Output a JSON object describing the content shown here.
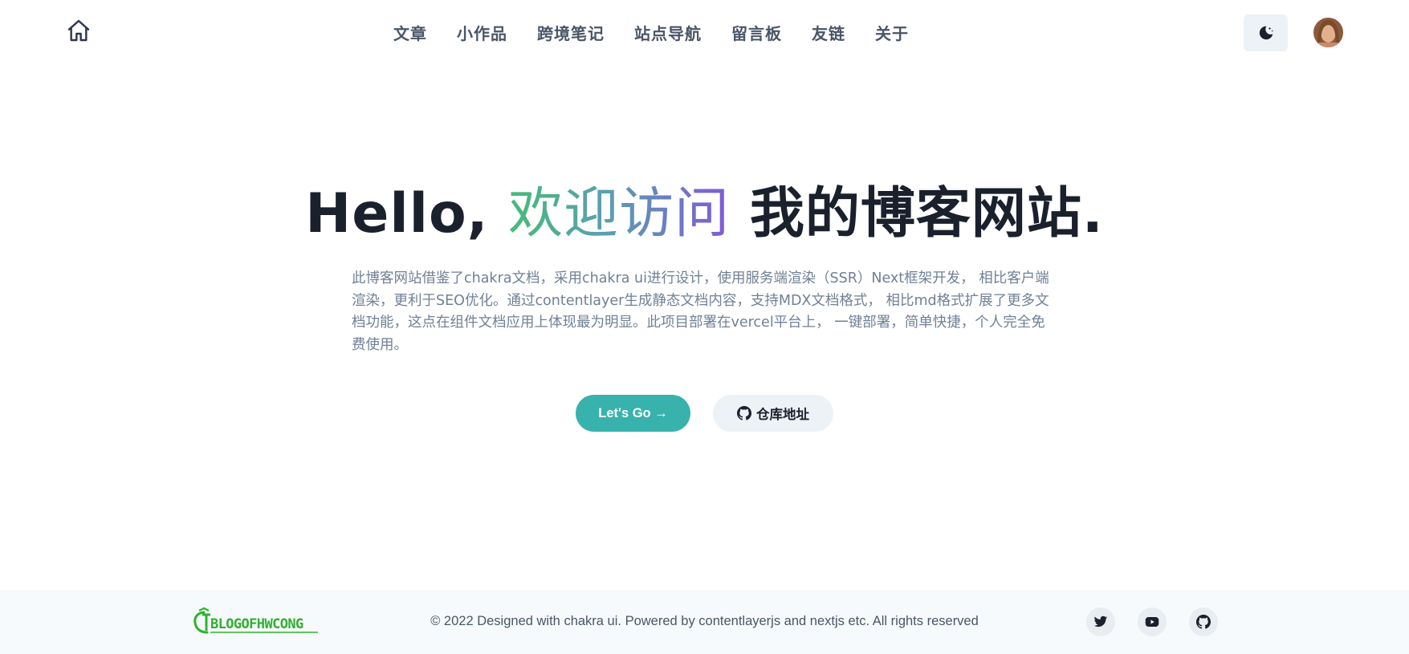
{
  "header": {
    "nav": [
      "文章",
      "小作品",
      "跨境笔记",
      "站点导航",
      "留言板",
      "友链",
      "关于"
    ]
  },
  "hero": {
    "title_prefix": "Hello, ",
    "title_highlight": "欢迎访问",
    "title_suffix": " 我的博客网站.",
    "description": "此博客网站借鉴了chakra文档，采用chakra ui进行设计，使用服务端渲染（SSR）Next框架开发， 相比客户端渲染，更利于SEO优化。通过contentlayer生成静态文档内容，支持MDX文档格式， 相比md格式扩展了更多文档功能，这点在组件文档应用上体现最为明显。此项目部署在vercel平台上， 一键部署，简单快捷，个人完全免费使用。",
    "primary_button": "Let's Go →",
    "secondary_button": "仓库地址"
  },
  "footer": {
    "logo_text": "BLOGOFHWCONG",
    "copyright": "© 2022 Designed with chakra ui. Powered by contentlayerjs and nextjs etc. All rights reserved"
  },
  "colors": {
    "accent": "#38b2ac",
    "gradient_start": "#48bb78",
    "gradient_end": "#805ad5",
    "logo_green": "#2fb12f"
  },
  "icons": {
    "home": "home-icon",
    "theme": "moon-icon",
    "repo": "github-icon",
    "social": [
      "twitter-icon",
      "youtube-icon",
      "github-icon"
    ]
  }
}
